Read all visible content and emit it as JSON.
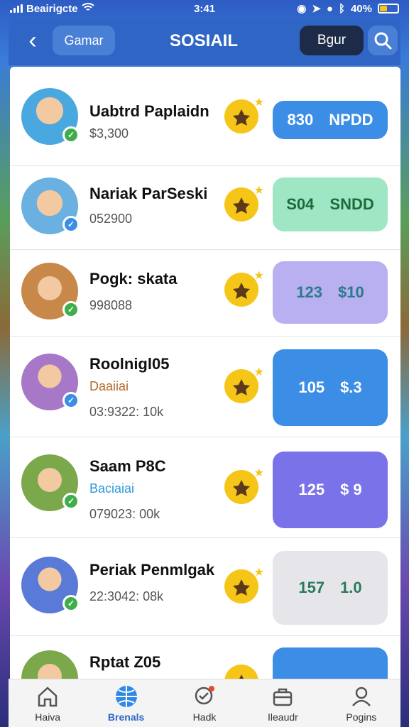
{
  "status": {
    "carrier": "Beairigcte",
    "time": "3:41",
    "battery": "40%"
  },
  "header": {
    "back_label": "‹",
    "left_pill": "Gamar",
    "title": "SOSIAIL",
    "right_button": "Bgur"
  },
  "rows": [
    {
      "name": "Uabtrd Paplaidn",
      "sub": "$3,300",
      "tag": "",
      "action_a": "830",
      "action_b": "NPDD",
      "avatar_color": "#4aa8e0",
      "badge_color": "#3fae4a",
      "action_bg": "#3b8de6",
      "action_fg": "#ffffff"
    },
    {
      "name": "Nariak ParSeski",
      "sub": "052900",
      "tag": "",
      "action_a": "S04",
      "action_b": "SNDD",
      "avatar_color": "#6ab0e0",
      "badge_color": "#3b8de6",
      "action_bg": "#9ee6c4",
      "action_fg": "#1e6a3a"
    },
    {
      "name": "Pogk: skata",
      "sub": "998088",
      "tag": "",
      "action_a": "123",
      "action_b": "$10",
      "avatar_color": "#c8884a",
      "badge_color": "#3fae4a",
      "action_bg": "#b8b0f0",
      "action_fg": "#2a7a8a"
    },
    {
      "name": "Roolnigl05",
      "sub": "03:9322: 10k",
      "tag": "Daaiiai",
      "action_a": "105",
      "action_b": "$.3",
      "avatar_color": "#a878c8",
      "badge_color": "#3b8de6",
      "action_bg": "#3b8de6",
      "action_fg": "#ffffff"
    },
    {
      "name": "Saam P8C",
      "sub": "079023: 00k",
      "tag": "Baciaiai",
      "action_a": "125",
      "action_b": "$ 9",
      "avatar_color": "#7aa84a",
      "badge_color": "#3fae4a",
      "action_bg": "#7a72e8",
      "action_fg": "#ffffff"
    },
    {
      "name": "Periak Penmlgak",
      "sub": "22:3042: 08k",
      "tag": "",
      "action_a": "157",
      "action_b": "1.0",
      "avatar_color": "#5a7ad8",
      "badge_color": "#3fae4a",
      "action_bg": "#e6e6ea",
      "action_fg": "#2a7a5a"
    },
    {
      "name": "Rptat Z05",
      "sub": "",
      "tag": "",
      "action_a": "",
      "action_b": "",
      "avatar_color": "#7aa84a",
      "badge_color": "#3fae4a",
      "action_bg": "#3b8de6",
      "action_fg": "#ffffff"
    }
  ],
  "tabs": [
    {
      "label": "Haiva",
      "icon": "home-icon"
    },
    {
      "label": "Brenals",
      "icon": "globe-icon"
    },
    {
      "label": "Hadk",
      "icon": "chat-icon"
    },
    {
      "label": "Ileaudr",
      "icon": "bag-icon"
    },
    {
      "label": "Pogins",
      "icon": "user-icon"
    }
  ]
}
